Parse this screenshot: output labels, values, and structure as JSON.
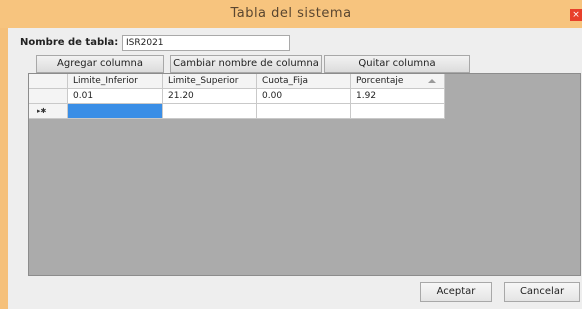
{
  "window": {
    "title": "Tabla del sistema",
    "close_glyph": "×"
  },
  "form": {
    "name_label": "Nombre de tabla:",
    "name_value": "ISR2021"
  },
  "toolbar": {
    "add_column": "Agregar columna",
    "rename_column": "Cambiar nombre de columna",
    "remove_column": "Quitar columna"
  },
  "table": {
    "columns": [
      "Limite_Inferior",
      "Limite_Superior",
      "Cuota_Fija",
      "Porcentaje"
    ],
    "rows": [
      [
        "0.01",
        "21.20",
        "0.00",
        "1.92"
      ]
    ],
    "new_row_marker": "▸✱",
    "sort_indicator": "ascending"
  },
  "footer": {
    "accept": "Aceptar",
    "cancel": "Cancelar"
  },
  "colors": {
    "titlebar": "#f7c47e",
    "selection": "#3a8ee6",
    "grid_background": "#ababab"
  }
}
